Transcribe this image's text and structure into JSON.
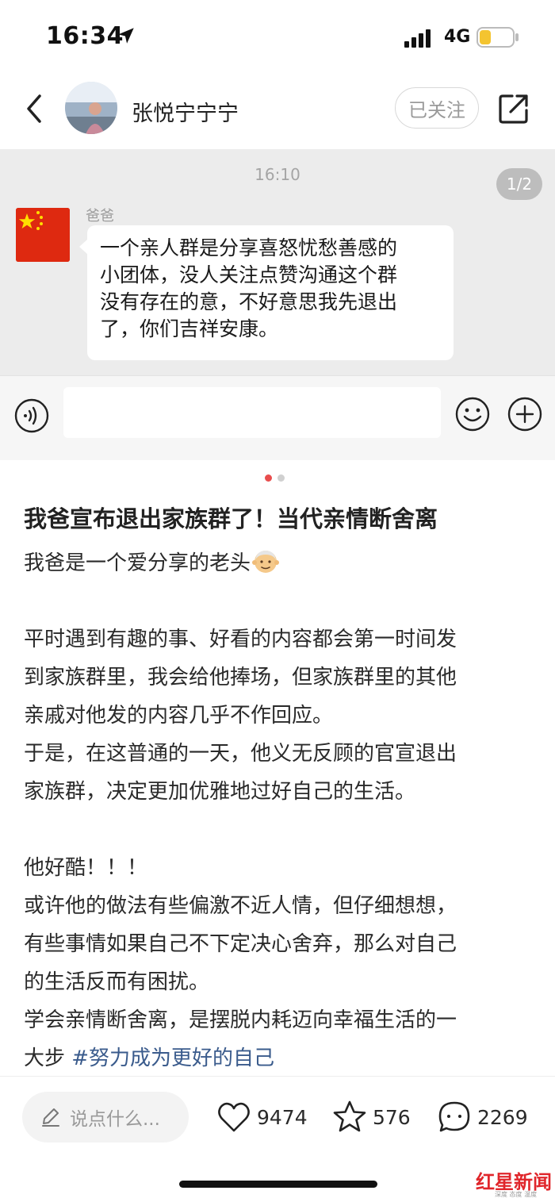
{
  "status_bar": {
    "time": "16:34",
    "network": "4G",
    "battery_level": 0.35,
    "icons": [
      "location-arrow-icon",
      "signal-icon",
      "battery-icon"
    ]
  },
  "header": {
    "username": "张悦宁宁宁",
    "follow_label": "已关注",
    "icons": [
      "back-icon",
      "share-icon"
    ]
  },
  "chat_screenshot": {
    "time": "16:10",
    "page_indicator": "1/2",
    "sender_name": "爸爸",
    "message_lines": [
      "一个亲人群是分享喜怒忧愁善感的",
      "小团体，没人关注点赞沟通这个群",
      "没有存在的意，不好意思我先退出",
      "了，你们吉祥安康。"
    ],
    "icons": [
      "china-flag-avatar",
      "voice-icon",
      "emoji-icon",
      "plus-icon"
    ]
  },
  "carousel": {
    "active_index": 0,
    "total": 2,
    "active_color": "#e84d4d",
    "inactive_color": "#d0d0d0"
  },
  "post": {
    "title": "我爸宣布退出家族群了！当代亲情断舍离",
    "lines": [
      "我爸是一个爱分享的老头",
      "",
      "平时遇到有趣的事、好看的内容都会第一时间发",
      "到家族群里，我会给他捧场，但家族群里的其他",
      "亲戚对他发的内容几乎不作回应。",
      "于是，在这普通的一天，他义无反顾的官宣退出",
      "家族群，决定更加优雅地过好自己的生活。",
      "",
      "他好酷！！！",
      "或许他的做法有些偏激不近人情，但仔细想想，",
      "有些事情如果自己不下定决心舍弃，那么对自己",
      "的生活反而有困扰。",
      "学会亲情断舍离，是摆脱内耗迈向幸福生活的一"
    ],
    "last_line_text": "大步 ",
    "hashtag": "#努力成为更好的自己",
    "hashtag_color": "#3a5b8c"
  },
  "bottom_bar": {
    "comment_placeholder": "说点什么...",
    "likes": "9474",
    "favorites": "576",
    "comments": "2269",
    "icons": [
      "pencil-icon",
      "heart-icon",
      "star-icon",
      "comment-bubble-icon"
    ]
  },
  "watermark": {
    "text": "红星新闻",
    "subtext": "深度 态度 温度",
    "color": "#e0262b"
  }
}
